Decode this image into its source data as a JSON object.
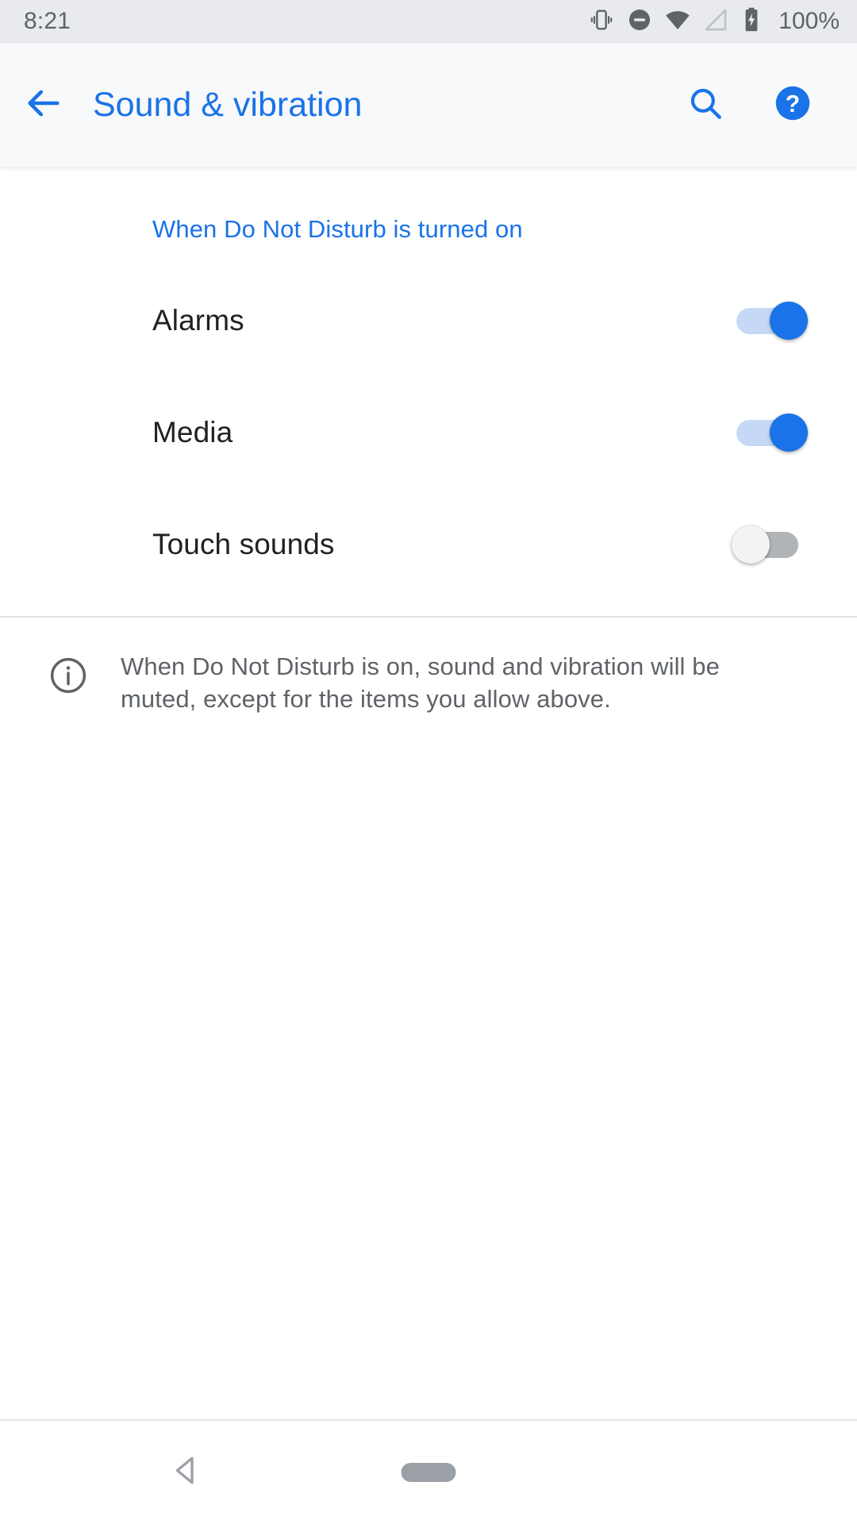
{
  "status_bar": {
    "time": "8:21",
    "battery_percent": "100%",
    "icons": [
      "vibrate-icon",
      "do-not-disturb-icon",
      "wifi-icon",
      "cell-signal-icon",
      "battery-charging-icon"
    ]
  },
  "app_bar": {
    "back_icon": "back-arrow-icon",
    "title": "Sound & vibration",
    "search_icon": "search-icon",
    "help_icon": "help-icon"
  },
  "content": {
    "section_header": "When Do Not Disturb is turned on",
    "preferences": [
      {
        "label": "Alarms",
        "state": "on"
      },
      {
        "label": "Media",
        "state": "on"
      },
      {
        "label": "Touch sounds",
        "state": "off"
      }
    ],
    "footer": {
      "icon": "info-icon",
      "text": "When Do Not Disturb is on, sound and vibration will be muted, except for the items you allow above."
    }
  },
  "nav_bar": {
    "back_icon": "nav-back-icon",
    "home_icon": "nav-home-pill-icon"
  },
  "colors": {
    "accent": "#1a73e8",
    "status_bar_bg": "#e8eaed",
    "app_bar_bg": "#f8f9fa",
    "primary_text": "#202124",
    "secondary_text": "#5f6368",
    "switch_on_track": "#c5d9f7",
    "switch_off_track": "#b1b4b6"
  }
}
